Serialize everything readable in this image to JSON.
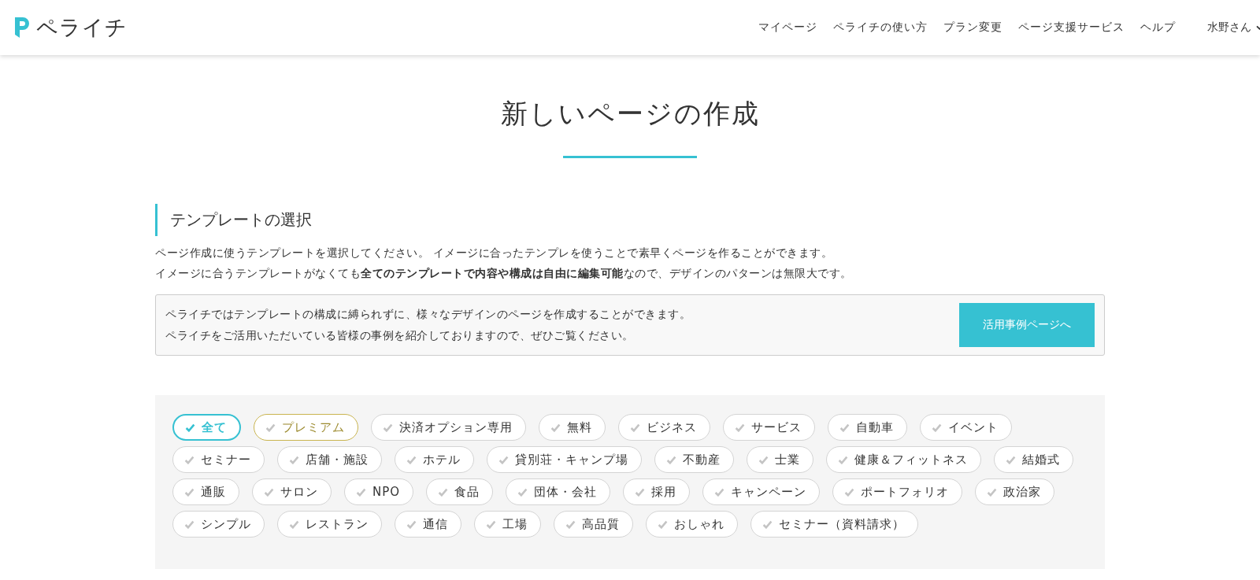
{
  "header": {
    "logo_text": "ペライチ",
    "nav": [
      "マイページ",
      "ペライチの使い方",
      "プラン変更",
      "ページ支援サービス",
      "ヘルプ"
    ],
    "user": "水野さん"
  },
  "page_title": "新しいページの作成",
  "section": {
    "heading": "テンプレートの選択",
    "description": [
      "ページ作成に使うテンプレートを選択してください。 イメージに合ったテンプレを使うことで素早くページを作ることができます。",
      "イメージに合うテンプレートがなくても**全てのテンプレートで内容や構成は自由に編集可能**なので、デザインのパターンは無限大です。"
    ],
    "notice": {
      "lines": [
        "ペライチではテンプレートの構成に縛られずに、様々なデザインのページを作成することができます。",
        "ペライチをご活用いただいている皆様の事例を紹介しておりますので、ぜひご覧ください。"
      ],
      "button": "活用事例ページへ"
    }
  },
  "filters": [
    {
      "label": "全て",
      "kind": "tag",
      "selected": true
    },
    {
      "label": "プレミアム",
      "kind": "premium",
      "selected": false
    },
    {
      "label": "決済オプション専用",
      "kind": "tag",
      "selected": false
    },
    {
      "label": "無料",
      "kind": "tag",
      "selected": false
    },
    {
      "label": "ビジネス",
      "kind": "tag",
      "selected": false
    },
    {
      "label": "サービス",
      "kind": "tag",
      "selected": false
    },
    {
      "label": "自動車",
      "kind": "tag",
      "selected": false
    },
    {
      "label": "イベント",
      "kind": "tag",
      "selected": false
    },
    {
      "label": "セミナー",
      "kind": "tag",
      "selected": false
    },
    {
      "label": "店舗・施設",
      "kind": "tag",
      "selected": false
    },
    {
      "label": "ホテル",
      "kind": "tag",
      "selected": false
    },
    {
      "label": "貸別荘・キャンプ場",
      "kind": "tag",
      "selected": false
    },
    {
      "label": "不動産",
      "kind": "tag",
      "selected": false
    },
    {
      "label": "士業",
      "kind": "tag",
      "selected": false
    },
    {
      "label": "健康＆フィットネス",
      "kind": "tag",
      "selected": false
    },
    {
      "label": "結婚式",
      "kind": "tag",
      "selected": false
    },
    {
      "label": "通販",
      "kind": "tag",
      "selected": false
    },
    {
      "label": "サロン",
      "kind": "tag",
      "selected": false
    },
    {
      "label": "NPO",
      "kind": "tag",
      "selected": false
    },
    {
      "label": "食品",
      "kind": "tag",
      "selected": false
    },
    {
      "label": "団体・会社",
      "kind": "tag",
      "selected": false
    },
    {
      "label": "採用",
      "kind": "tag",
      "selected": false
    },
    {
      "label": "キャンペーン",
      "kind": "tag",
      "selected": false
    },
    {
      "label": "ポートフォリオ",
      "kind": "tag",
      "selected": false
    },
    {
      "label": "政治家",
      "kind": "tag",
      "selected": false
    },
    {
      "label": "シンプル",
      "kind": "tag",
      "selected": false
    },
    {
      "label": "レストラン",
      "kind": "tag",
      "selected": false
    },
    {
      "label": "通信",
      "kind": "tag",
      "selected": false
    },
    {
      "label": "工場",
      "kind": "tag",
      "selected": false
    },
    {
      "label": "高品質",
      "kind": "tag",
      "selected": false
    },
    {
      "label": "おしゃれ",
      "kind": "tag",
      "selected": false
    },
    {
      "label": "セミナー（資料請求）",
      "kind": "tag",
      "selected": false
    }
  ]
}
